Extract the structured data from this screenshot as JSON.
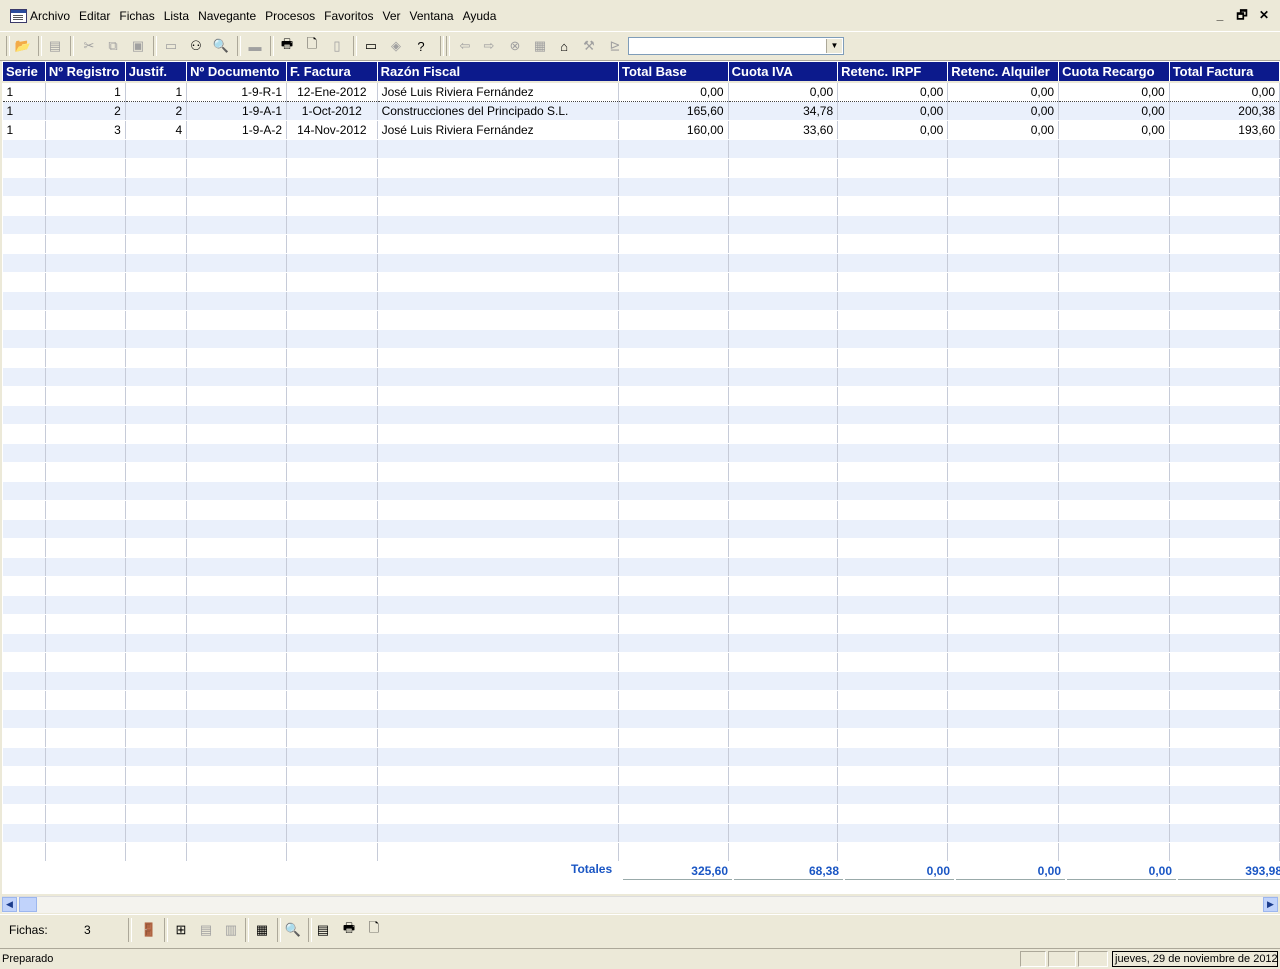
{
  "menu": [
    "Archivo",
    "Editar",
    "Fichas",
    "Lista",
    "Navegante",
    "Procesos",
    "Favoritos",
    "Ver",
    "Ventana",
    "Ayuda"
  ],
  "window_controls": {
    "minimize": "_",
    "restore": "🗗",
    "close": "✕"
  },
  "toolbar": {
    "combo_value": "",
    "icons": [
      "open-folder-icon",
      "edit-doc-icon",
      "cut-icon",
      "copy-icon",
      "paste-icon",
      "window-icon",
      "binoculars-icon",
      "search-icon",
      "scanner-icon",
      "print-icon",
      "print-preview-icon",
      "page-icon",
      "monitor-icon",
      "eraser-icon",
      "help-icon",
      "back-arrow-icon",
      "forward-arrow-icon",
      "stop-icon",
      "calculator-icon",
      "home-icon",
      "filter-icon",
      "doc-arrow-icon"
    ]
  },
  "grid": {
    "columns": [
      "Serie",
      "Nº Registro",
      "Justif.",
      "Nº Documento",
      "F. Factura",
      "Razón Fiscal",
      "Total Base",
      "Cuota IVA",
      "Retenc. IRPF",
      "Retenc. Alquiler",
      "Cuota Recargo",
      "Total Factura"
    ],
    "rows": [
      [
        "1",
        "1",
        "1",
        "1-9-R-1",
        "12-Ene-2012",
        "José Luis Riviera Fernández",
        "0,00",
        "0,00",
        "0,00",
        "0,00",
        "0,00",
        "0,00"
      ],
      [
        "1",
        "2",
        "2",
        "1-9-A-1",
        "1-Oct-2012",
        "Construcciones del Principado S.L.",
        "165,60",
        "34,78",
        "0,00",
        "0,00",
        "0,00",
        "200,38"
      ],
      [
        "1",
        "3",
        "4",
        "1-9-A-2",
        "14-Nov-2012",
        "José Luis Riviera Fernández",
        "160,00",
        "33,60",
        "0,00",
        "0,00",
        "0,00",
        "193,60"
      ]
    ]
  },
  "totals": {
    "label": "Totales",
    "values": [
      "325,60",
      "68,38",
      "0,00",
      "0,00",
      "0,00",
      "393,98"
    ]
  },
  "bottombar": {
    "fichas_label": "Fichas:",
    "fichas_count": "3"
  },
  "status": {
    "text": "Preparado",
    "date": "jueves, 29 de noviembre de 2012"
  }
}
